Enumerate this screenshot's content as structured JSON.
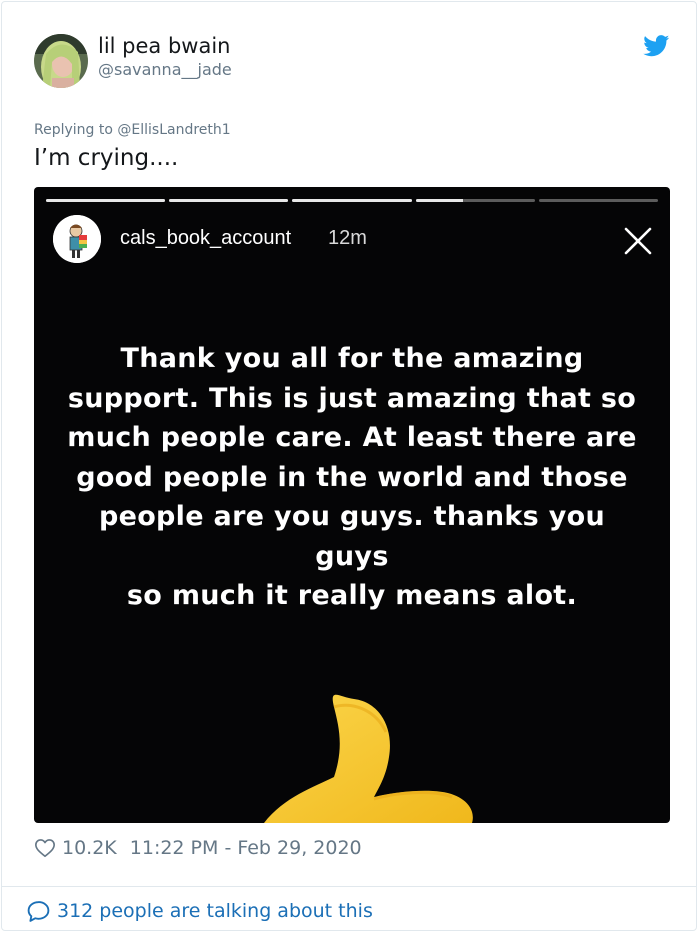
{
  "tweet": {
    "author": {
      "display_name": "lil pea bwain",
      "handle": "@savanna__jade"
    },
    "replying_to_prefix": "Replying to ",
    "replying_to_handle": "@EllisLandreth1",
    "text": "I’m crying....",
    "likes": "10.2K",
    "timestamp": "11:22 PM - Feb 29, 2020",
    "conversation_label": "312 people are talking about this"
  },
  "story": {
    "username": "cals_book_account",
    "time_ago": "12m",
    "progress": [
      1,
      1,
      1,
      0.4,
      0
    ],
    "message_lines": [
      "Thank you all for the amazing",
      "support. This is just amazing that so",
      "much people care. At least there are",
      "good people in the world and those",
      "people are you guys. thanks you guys",
      "so much it really means alot."
    ]
  },
  "colors": {
    "brand_blue": "#1da1f2",
    "link_blue": "#1b6fb6",
    "muted_gray": "#657786",
    "emoji_yellow": "#f7c42b"
  },
  "icons": {
    "brand": "twitter-bird-icon",
    "like": "heart-icon",
    "close": "close-icon",
    "conversation": "speech-bubble-icon"
  }
}
